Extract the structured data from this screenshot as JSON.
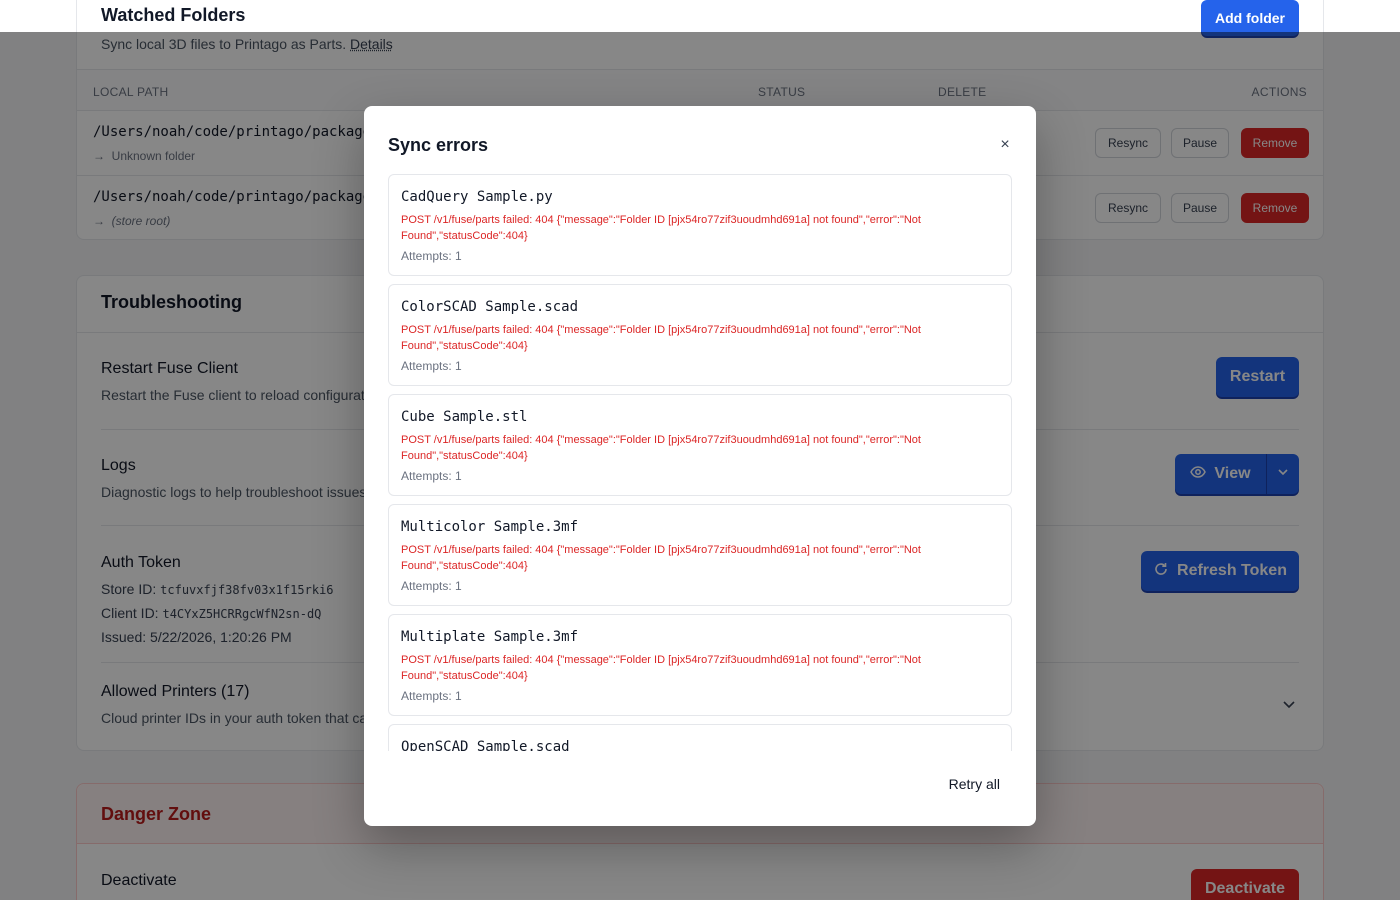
{
  "watched_folders": {
    "title": "Watched Folders",
    "add_label": "Add folder",
    "subtitle": "Sync local 3D files to Printago as Parts.",
    "details_link": "Details",
    "columns": {
      "path": "LOCAL PATH",
      "status": "STATUS",
      "delete": "DELETE",
      "actions": "ACTIONS"
    },
    "rows": [
      {
        "path": "/Users/noah/code/printago/packages",
        "sub": "Unknown folder",
        "sub_italic": false,
        "resync": "Resync",
        "pause": "Pause",
        "remove": "Remove"
      },
      {
        "path": "/Users/noah/code/printago/packages",
        "sub": "(store root)",
        "sub_italic": true,
        "resync": "Resync",
        "pause": "Pause",
        "remove": "Remove"
      }
    ]
  },
  "troubleshooting": {
    "title": "Troubleshooting",
    "restart": {
      "title": "Restart Fuse Client",
      "desc": "Restart the Fuse client to reload configuration.",
      "button": "Restart"
    },
    "logs": {
      "title": "Logs",
      "desc": "Diagnostic logs to help troubleshoot issues.",
      "button": "View"
    },
    "auth": {
      "title": "Auth Token",
      "store_label": "Store ID:",
      "store_id": "tcfuvxfjf38fv03x1f15rki6",
      "client_label": "Client ID:",
      "client_id": "t4CYxZ5HCRRgcWfN2sn-dQ",
      "issued_label": "Issued:",
      "issued": "5/22/2026, 1:20:26 PM",
      "button": "Refresh Token"
    },
    "printers": {
      "title": "Allowed Printers (17)",
      "desc": "Cloud printer IDs in your auth token that can be used."
    }
  },
  "danger_zone": {
    "title": "Danger Zone",
    "deactivate_title": "Deactivate",
    "deactivate_button": "Deactivate"
  },
  "modal": {
    "title": "Sync errors",
    "close": "×",
    "retry_label": "Retry all",
    "errors": [
      {
        "file": "CadQuery Sample.py",
        "message": "POST /v1/fuse/parts failed: 404 {\"message\":\"Folder ID [pjx54ro77zif3uoudmhd691a] not found\",\"error\":\"Not Found\",\"statusCode\":404}",
        "attempts": "Attempts: 1"
      },
      {
        "file": "ColorSCAD Sample.scad",
        "message": "POST /v1/fuse/parts failed: 404 {\"message\":\"Folder ID [pjx54ro77zif3uoudmhd691a] not found\",\"error\":\"Not Found\",\"statusCode\":404}",
        "attempts": "Attempts: 1"
      },
      {
        "file": "Cube Sample.stl",
        "message": "POST /v1/fuse/parts failed: 404 {\"message\":\"Folder ID [pjx54ro77zif3uoudmhd691a] not found\",\"error\":\"Not Found\",\"statusCode\":404}",
        "attempts": "Attempts: 1"
      },
      {
        "file": "Multicolor Sample.3mf",
        "message": "POST /v1/fuse/parts failed: 404 {\"message\":\"Folder ID [pjx54ro77zif3uoudmhd691a] not found\",\"error\":\"Not Found\",\"statusCode\":404}",
        "attempts": "Attempts: 1"
      },
      {
        "file": "Multiplate Sample.3mf",
        "message": "POST /v1/fuse/parts failed: 404 {\"message\":\"Folder ID [pjx54ro77zif3uoudmhd691a] not found\",\"error\":\"Not Found\",\"statusCode\":404}",
        "attempts": "Attempts: 1"
      },
      {
        "file": "OpenSCAD Sample.scad",
        "message": "",
        "attempts": ""
      }
    ]
  },
  "colors": {
    "primary": "#2563eb",
    "danger": "#dc2626",
    "error_text": "#dc2626"
  }
}
